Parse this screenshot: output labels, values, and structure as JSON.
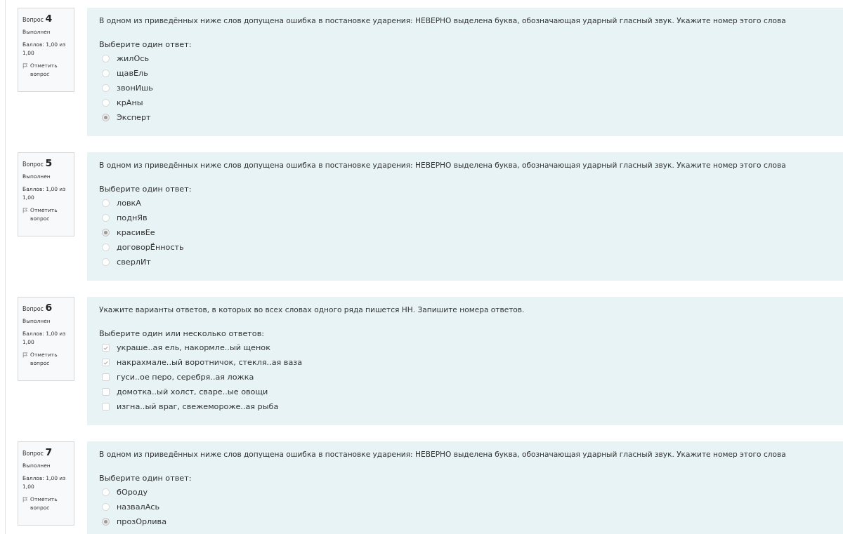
{
  "questions": [
    {
      "label": "Вопрос",
      "number": "4",
      "status": "Выполнен",
      "score": "Баллов: 1,00 из 1,00",
      "flag": "Отметить вопрос",
      "text": "В одном из приведённых ниже слов допущена ошибка в постановке ударения: НЕВЕРНО выделена буква, обозначающая ударный гласный звук. Укажите номер этого слова",
      "prompt": "Выберите один ответ:",
      "kind": "single",
      "options": [
        {
          "text": "жилОсь",
          "selected": false
        },
        {
          "text": "щавЕль",
          "selected": false
        },
        {
          "text": "звонИшь",
          "selected": false
        },
        {
          "text": "крАны",
          "selected": false
        },
        {
          "text": "Эксперт",
          "selected": true
        }
      ]
    },
    {
      "label": "Вопрос",
      "number": "5",
      "status": "Выполнен",
      "score": "Баллов: 1,00 из 1,00",
      "flag": "Отметить вопрос",
      "text": "В одном из приведённых ниже слов допущена ошибка в постановке ударения: НЕВЕРНО выделена буква, обозначающая ударный гласный звук. Укажите номер этого слова",
      "prompt": "Выберите один ответ:",
      "kind": "single",
      "options": [
        {
          "text": "ловкА",
          "selected": false
        },
        {
          "text": "поднЯв",
          "selected": false
        },
        {
          "text": "красивЕе",
          "selected": true
        },
        {
          "text": "договорЁнность",
          "selected": false
        },
        {
          "text": "сверлИт",
          "selected": false
        }
      ]
    },
    {
      "label": "Вопрос",
      "number": "6",
      "status": "Выполнен",
      "score": "Баллов: 1,00 из 1,00",
      "flag": "Отметить вопрос",
      "text": "Укажите варианты ответов, в которых во всех словах одного ряда пишется НН. Запишите номера ответов.",
      "prompt": "Выберите один или несколько ответов:",
      "kind": "multiple",
      "options": [
        {
          "text": "украше..ая ель, накормле..ый щенок",
          "selected": true
        },
        {
          "text": "накрахмале..ый воротничок, стекля..ая ваза",
          "selected": true
        },
        {
          "text": "гуси..ое перо, серебря..ая ложка",
          "selected": false
        },
        {
          "text": "домотка..ый холст, сваре..ые овощи",
          "selected": false
        },
        {
          "text": "изгна..ый враг, свежемороже..ая рыба",
          "selected": false
        }
      ]
    },
    {
      "label": "Вопрос",
      "number": "7",
      "status": "Выполнен",
      "score": "Баллов: 1,00 из 1,00",
      "flag": "Отметить вопрос",
      "text": "В одном из приведённых ниже слов допущена ошибка в постановке ударения: НЕВЕРНО выделена буква, обозначающая ударный гласный звук. Укажите номер этого слова",
      "prompt": "Выберите один ответ:",
      "kind": "single",
      "options": [
        {
          "text": "бОроду",
          "selected": false
        },
        {
          "text": "назвалАсь",
          "selected": false
        },
        {
          "text": "прозОрлива",
          "selected": true
        }
      ]
    }
  ]
}
